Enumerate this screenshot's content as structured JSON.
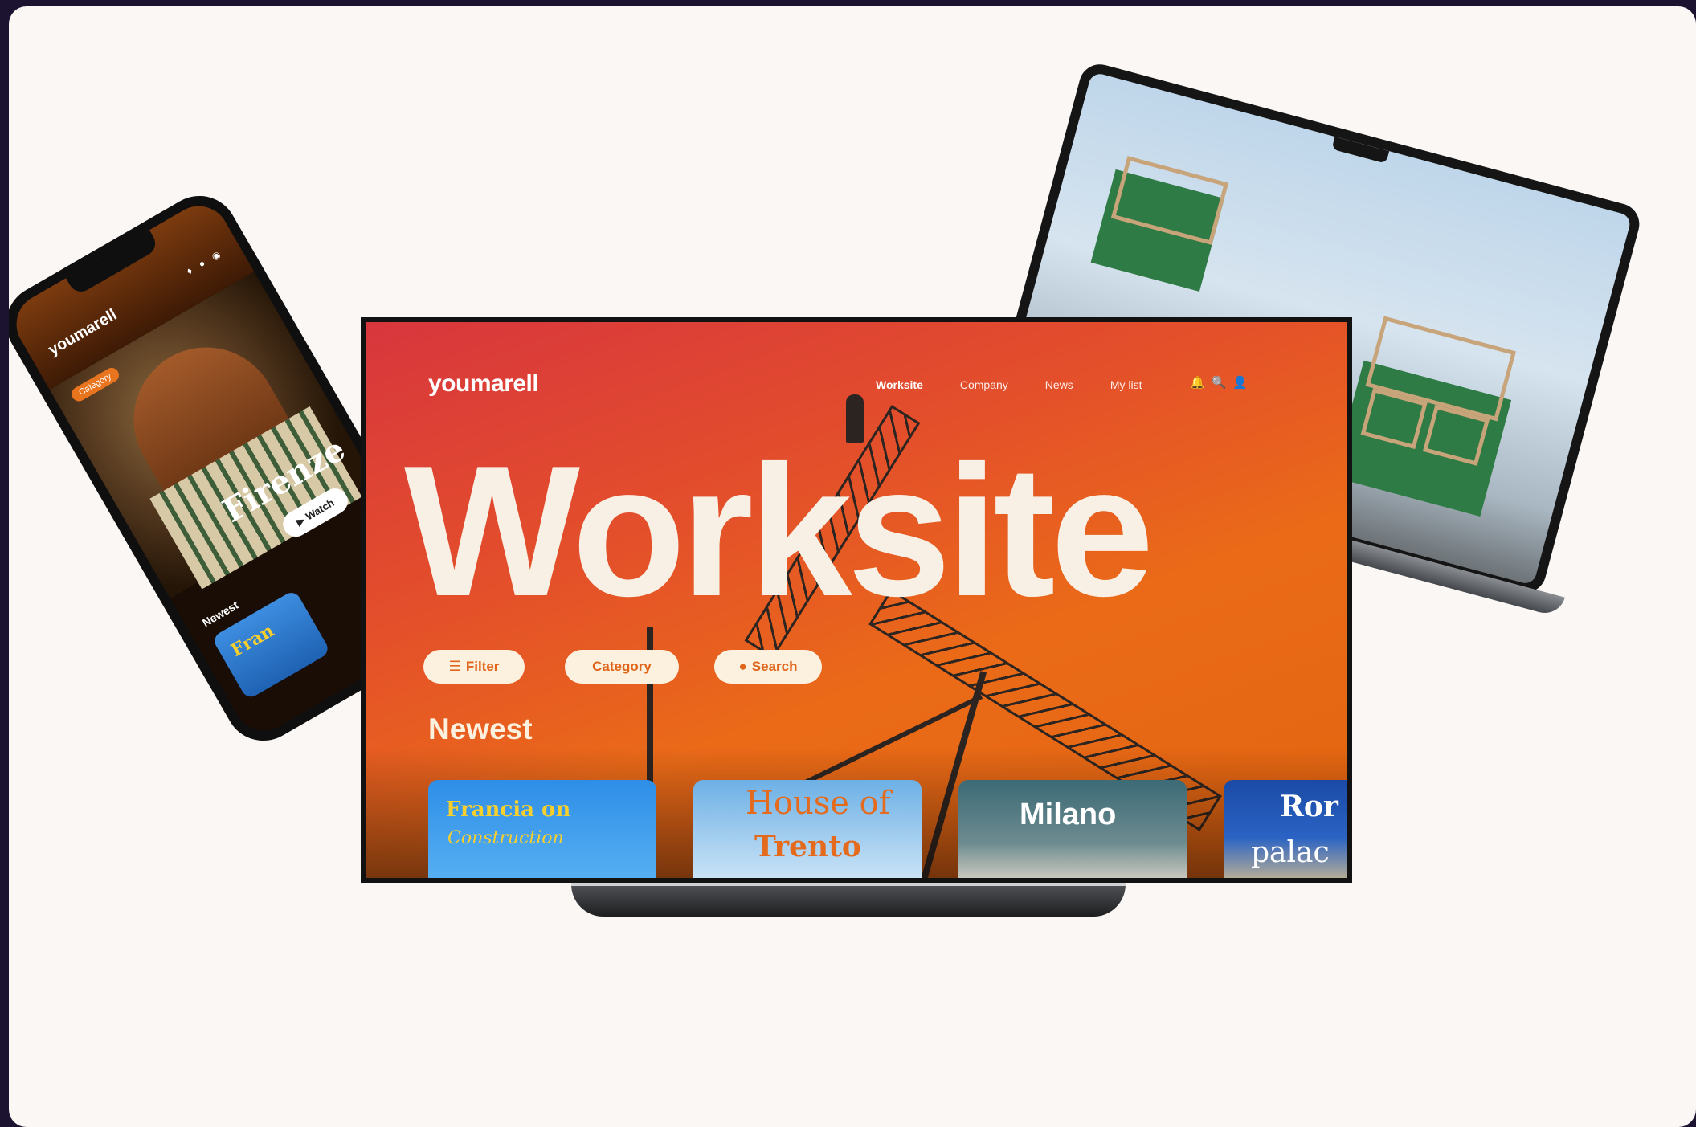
{
  "laptop": {
    "controls": [
      "audio-icon",
      "captions-icon",
      "settings-icon",
      "fullscreen-icon"
    ]
  },
  "phone": {
    "logo": "youmarell",
    "icons": "♦ ● ◉",
    "badge": "Category",
    "title": "Firenze",
    "watch": "Watch",
    "newest": "Newest",
    "thumb_text": "Fran"
  },
  "tv": {
    "logo": "youmarell",
    "nav": {
      "worksite": "Worksite",
      "company": "Company",
      "news": "News",
      "mylist": "My list"
    },
    "icons": {
      "bell": "🔔",
      "search": "🔍",
      "user": "👤"
    },
    "hero": "Worksite",
    "pills": {
      "filter": "Filter",
      "category": "Category",
      "search": "Search"
    },
    "newest": "Newest",
    "thumbs": {
      "t1": {
        "a": "Francia on",
        "b": "Construction"
      },
      "t2": {
        "a": "House of",
        "b": "Trento"
      },
      "t3": {
        "a": "Milano"
      },
      "t4": {
        "a": "Ror",
        "b": "palac"
      }
    }
  },
  "colors": {
    "accent": "#e0651a",
    "cream": "#fbf1de",
    "background": "#faf7f4"
  }
}
